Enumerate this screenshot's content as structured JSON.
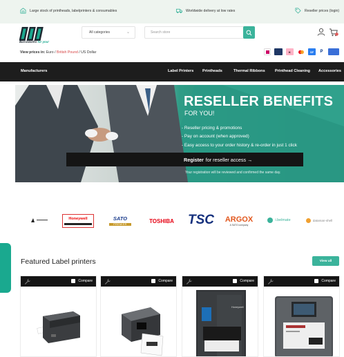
{
  "topbar": {
    "usp1": "Large stock of printheads, labelprinters & consumables",
    "usp2": "Worldwide delivery at low rates",
    "usp3": "Reseller prices (login)"
  },
  "header": {
    "logo_tagline_a": "Barcoworks",
    "logo_tagline_b": "for you!",
    "category_select": "All categories",
    "search_placeholder": "Search store"
  },
  "currency": {
    "label": "View prices in:",
    "euro": "Euro",
    "gbp": "British Pound",
    "usd": "US Dollar",
    "sep": " / "
  },
  "payments": [
    "iDEAL",
    "Bancontact",
    "Klarna",
    "Mastercard",
    "Sofort",
    "PayPal",
    "Bank"
  ],
  "nav": {
    "manufacturers": "Manufacturers",
    "items": [
      "Label Printers",
      "Printheads",
      "Thermal Ribbons",
      "Printhead Cleaning",
      "Accessories"
    ]
  },
  "hero": {
    "title": "RESELLER BENEFITS",
    "subtitle": "FOR YOU!",
    "bullets": [
      "- Reseller pricing & promotions",
      "- Pay on account (when approved)",
      "- Easy access to your order history & re-order in just 1 click"
    ],
    "cta_strong": "Register",
    "cta_rest": "for reseller access →",
    "note": "Your registration will be reviewed and confirmed the same day."
  },
  "brands": [
    "Honeywell",
    "SATO",
    "TOSHIBA",
    "TSC",
    "ARGOX",
    "i.belmate",
    "dataman-shell"
  ],
  "brand_captions": {
    "argox_sub": "A SATO company",
    "sato_sub": "PREMIER"
  },
  "featured": {
    "title": "Featured Label printers",
    "view_all": "View all",
    "compare_label": "Compare",
    "card_count": 4,
    "printer_brand_text": "Honeywell"
  },
  "colors": {
    "accent": "#3bb39b",
    "dark": "#1d1d1d",
    "topbar_bg": "#eef4ef",
    "link_red": "#d64545"
  }
}
